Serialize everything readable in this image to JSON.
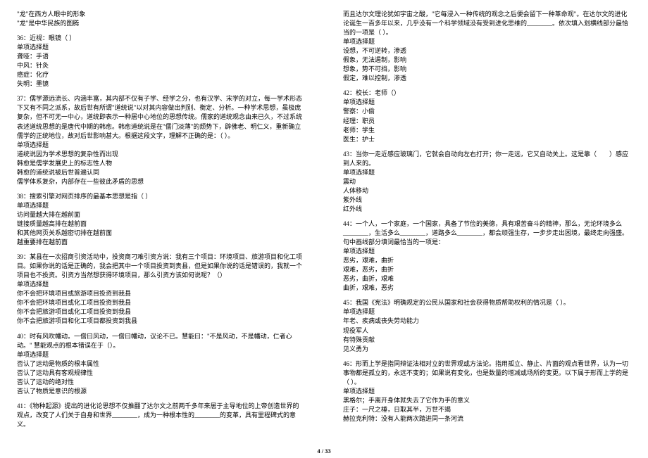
{
  "left": {
    "intro": [
      "\"龙\"在西方人眼中的形象",
      "\"龙\"是中华民族的图腾"
    ],
    "q36": {
      "title": "36：近视：眼镜（ ）",
      "type": "单项选择题",
      "opts": [
        "聋哑：手语",
        "中风：针灸",
        "癌症：化疗",
        "失明：墨镜"
      ]
    },
    "q37": {
      "text": "37：儒学源远流长、内涵丰富，其内部不仅有子学、经学之分，也有汉学、宋学的对立，每一学术形态下又有不同之派系，故后世有所谓\"道统说\"以对其内容做出判别、衡定、分析。一种学术思想，虽极庞复杂，但不可无一中心，道统即表示一种居中心地位的思想传统。儒家的道统观念由来已久，不过系统表述道统思想的是唐代中期的韩愈。韩愈道统说是在\"儒门淡薄\"的颓势下，辟佛老、明仁义，重新确立儒学的正统地位，故对后世影响甚大。根据这段文字，理解不正确的是：（ ）。",
      "type": "单项选择题",
      "opts": [
        "道统说因为学术思想的复杂性而出现",
        "韩愈是儒学发展史上的标志性人物",
        "韩愈的道统说被后世普遍认同",
        "儒学体系复杂，内部存在一些彼此矛盾的思想"
      ]
    },
    "q38": {
      "title": "38：搜索引擎对网页排序的最基本思想是指（  ）",
      "type": "单项选择题",
      "opts": [
        "访问量越大排在越前面",
        "链接质量越高排在越前面",
        "和其他网页关系越密切排在越前面",
        "越重要排在越前面"
      ]
    },
    "q39": {
      "text": "39：某县在一次招商引资活动中，投资商刁难引资方说：我有三个项目：环境项目、旅游项目和化工项目。如果你说的话是正确的，我会把其中一个项目投资到贵县，但是如果你说的话是错误的，我就一个项目也不投资。引资方当然想获得环境项目，那么引资方该如何说呢？（）",
      "type": "单项选择题",
      "opts": [
        "你不会把环境项目或旅游项目投资到我县",
        "你不会把环境项目或化工项目投资到我县",
        "你不会把旅游项目或化工项目投资到我县",
        "你不会把旅游项目和化工项目都投资到我县"
      ]
    },
    "q40": {
      "text": "40：时有风吹幡动。一僧曰风动，一僧曰幡动，议论不已。慧能曰：\"不是风动，不是幡动，仁者心动。\" 慧能观点的根本错误在于（）。",
      "type": "单项选择题",
      "opts": [
        "否认了运动是物质的根本属性",
        "否认了运动具有客观规律性",
        "否认了运动的绝对性",
        "否认了物质是意识的根源"
      ]
    },
    "q41": {
      "text": "41：《物种起源》提出的进化论思想不仅推翻了达尔文之前两千多年来居于主导地位的上帝创造世界的观点，改变了人们关于自身和世界________，成为一种根本性的________的变革，具有里程碑式的意义。"
    }
  },
  "right": {
    "q41cont": {
      "text": "而且达尔文理论犹如宇宙之酸，\"它每浸入一种传统的观念之后便会留下一种革命观\"。在达尔文的进化论诞生一百多年以来，几乎没有一个科学领域没有受到进化思维的________。依次填入划横线部分最恰当的一项是（ ）。",
      "type": "单项选择题",
      "opts": [
        "设想，不可逆转，渗透",
        "假象，无法遏制，影响",
        "想象，势不可挡，影响",
        "假定，难以控制，渗透"
      ]
    },
    "q42": {
      "title": "42：校长：老师（）",
      "type": "单项选择题",
      "opts": [
        "警察：小偷",
        "经理：职员",
        "老师：学生",
        "医生：护士"
      ]
    },
    "q43": {
      "text": "43：当你一走近感应玻璃门，它就会自动向左右打开；你一走远，它又自动关上。这是靠（　　）感应到人来的。",
      "type": "单项选择题",
      "opts": [
        "震动",
        "人体移动",
        "紫外线",
        "红外线"
      ]
    },
    "q44": {
      "text": "44：一个人，一个家庭，一个国家，具备了节俭的美德，具有艰苦奋斗的精神，那么，无论环境多么________，生活多么________，道路多么________，都会顽强生存，一步步走出困境，最终走向强盛。句中画线部分填词最恰当的一项是：",
      "type": "单项选择题",
      "opts": [
        "恶劣，艰难，曲折",
        "艰难，恶劣，曲折",
        "恶劣，曲折，艰难",
        "曲折，艰难，恶劣"
      ]
    },
    "q45": {
      "text": "45：我国《宪法》明确规定的公民从国家和社会获得物质帮助权利的情况是（ ）。",
      "type": "单项选择题",
      "opts": [
        "年老、疾病或丧失劳动能力",
        "现役军人",
        "有特殊贡献",
        "见义勇为"
      ]
    },
    "q46": {
      "text": "46：形而上学是指同辩证法相对立的世界观或方法论。指用孤立、静止、片面的观点看世界，认为一切事物都是孤立的，永远不变的；如果说有变化，也是数量的增减或场所的变更。以下属于形而上学的是（ ）。",
      "type": "单项选择题",
      "opts": [
        "黑格尔；手离开身体就失去了它作为手的意义",
        "庄子：一尺之棰，日取其半，万世不竭",
        "赫拉克利特：没有人能两次踏进同一条河流"
      ]
    }
  },
  "pagenum": "4 / 33"
}
